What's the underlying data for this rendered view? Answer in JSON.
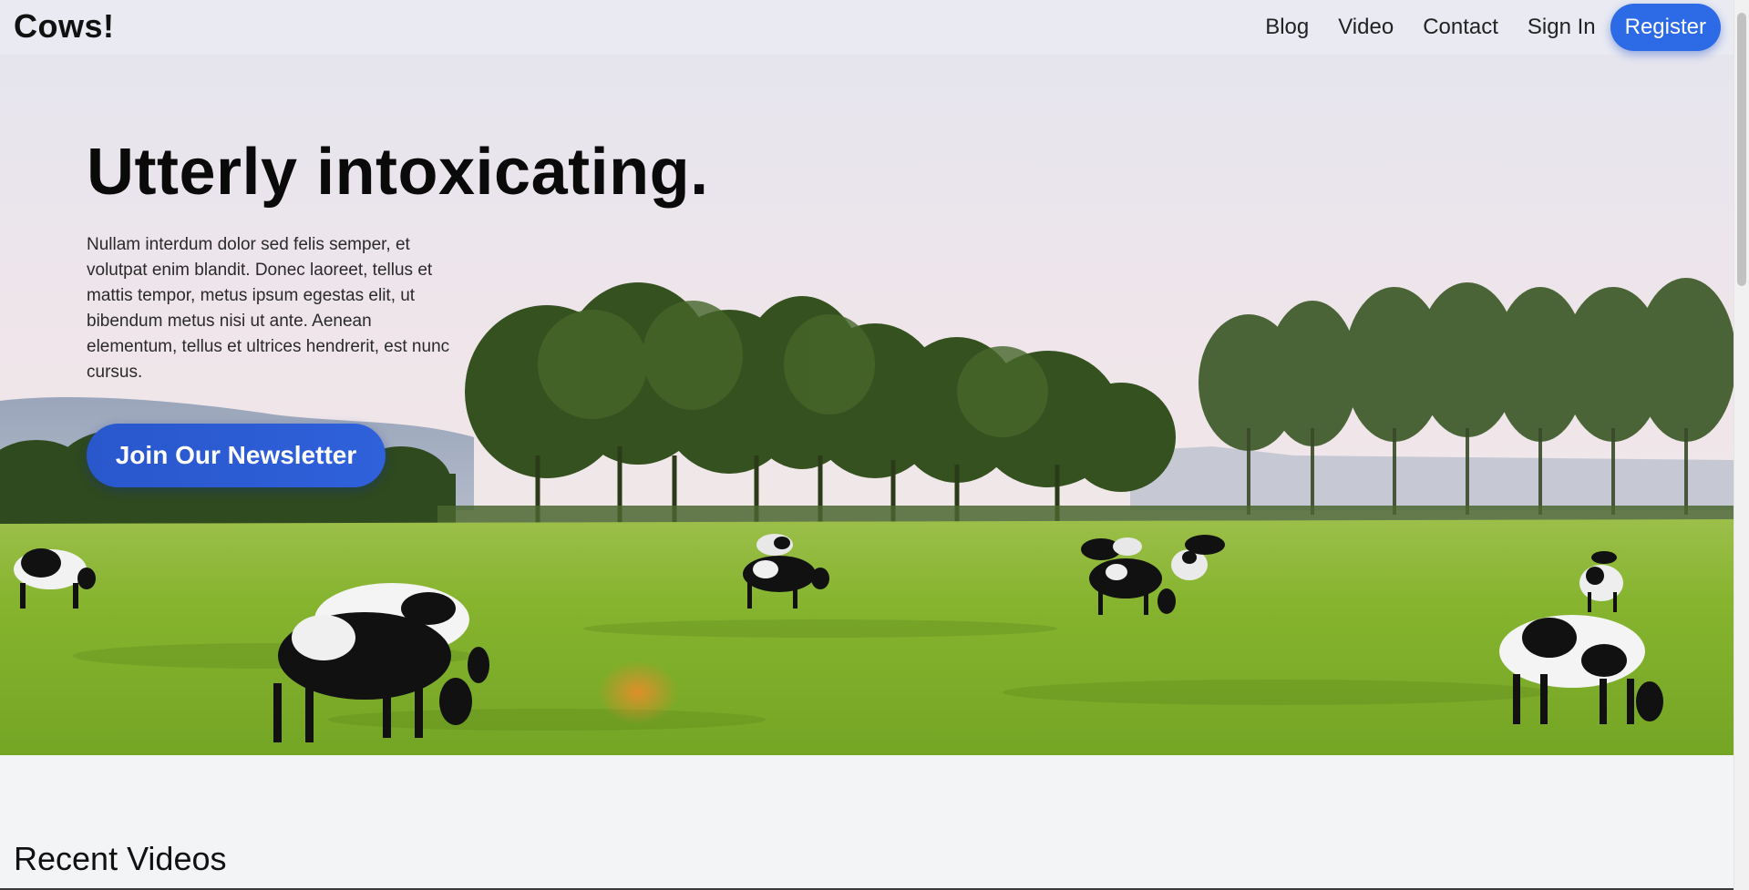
{
  "nav": {
    "brand": "Cows!",
    "links": [
      "Blog",
      "Video",
      "Contact",
      "Sign In"
    ],
    "register_label": "Register"
  },
  "hero": {
    "title": "Utterly intoxicating.",
    "text": "Nullam interdum dolor sed felis semper, et volutpat enim blandit. Donec laoreet, tellus et mattis tempor, metus ipsum egestas elit, ut bibendum metus nisi ut ante. Aenean elementum, tellus et ultrices hendrerit, est nunc cursus.",
    "cta_label": "Join Our Newsletter",
    "image": "cows-grazing-pasture"
  },
  "section": {
    "title": "Recent Videos"
  },
  "colors": {
    "accent": "#2d6ae6",
    "background": "#f3f4f6",
    "text": "#111111"
  }
}
